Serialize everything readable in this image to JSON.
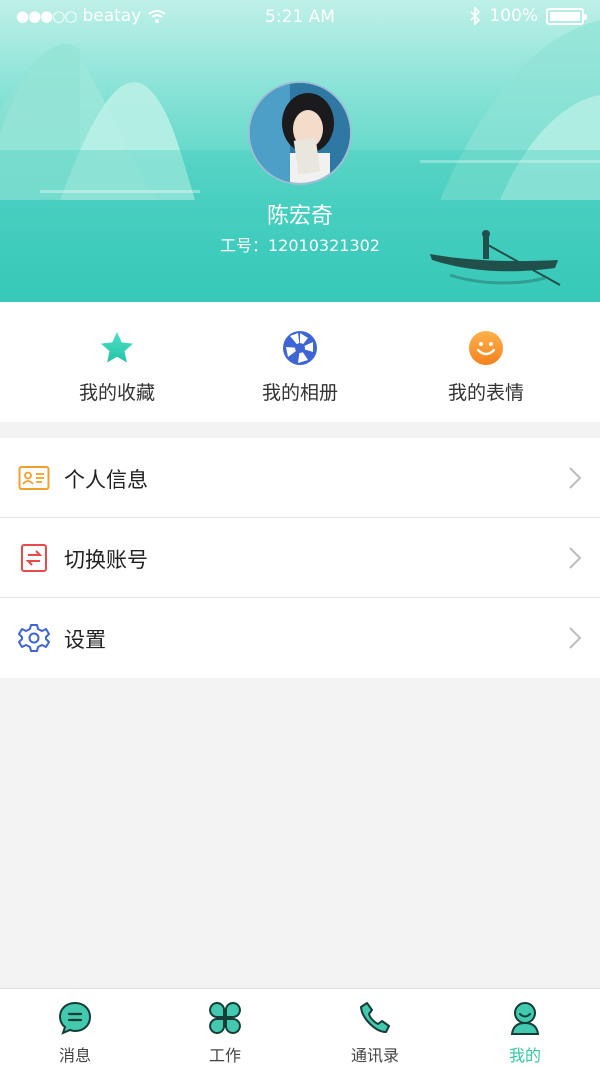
{
  "status_bar": {
    "carrier": "beatay",
    "time": "5:21 AM",
    "battery": "100%"
  },
  "profile": {
    "name": "陈宏奇",
    "job_number": "工号：12010321302"
  },
  "quick_actions": [
    {
      "label": "我的收藏",
      "icon": "star-icon",
      "color": "#2ecfb3"
    },
    {
      "label": "我的相册",
      "icon": "camera-aperture-icon",
      "color": "#3e64d6"
    },
    {
      "label": "我的表情",
      "icon": "smiley-icon",
      "color": "#f7941d"
    }
  ],
  "menu": [
    {
      "label": "个人信息",
      "icon": "id-card-icon",
      "color": "#f0a02c"
    },
    {
      "label": "切换账号",
      "icon": "switch-account-icon",
      "color": "#e84a4a"
    },
    {
      "label": "设置",
      "icon": "gear-icon",
      "color": "#3e64d6"
    }
  ],
  "tabs": [
    {
      "label": "消息",
      "icon": "message-icon",
      "active": false
    },
    {
      "label": "工作",
      "icon": "grid-clover-icon",
      "active": false
    },
    {
      "label": "通讯录",
      "icon": "phone-icon",
      "active": false
    },
    {
      "label": "我的",
      "icon": "person-icon",
      "active": true
    }
  ],
  "colors": {
    "accent": "#35c6a6",
    "hero_teal": "#49d0c2"
  }
}
